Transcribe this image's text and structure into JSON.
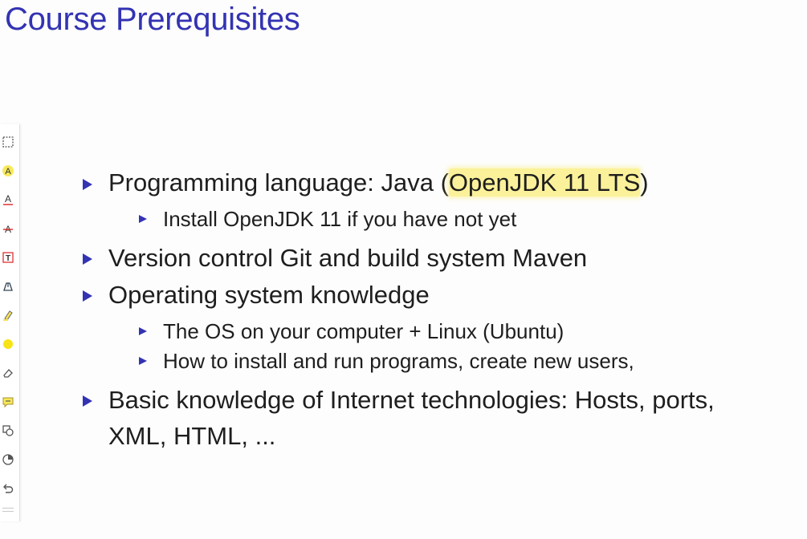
{
  "slide": {
    "title": "Course Prerequisites",
    "items": [
      {
        "pre": "Programming language: Java (",
        "highlight": "OpenJDK 11 LTS",
        "post": ")",
        "sub": [
          "Install OpenJDK 11 if you have not yet"
        ]
      },
      {
        "text": "Version control Git and build system Maven"
      },
      {
        "text": "Operating system knowledge",
        "sub": [
          "The OS on your computer + Linux (Ubuntu)",
          "How to install and run programs, create new users,"
        ]
      },
      {
        "line1": "Basic knowledge of Internet technologies: Hosts, ports,",
        "line2": "XML, HTML, ..."
      }
    ]
  },
  "toolbar": {
    "tools": [
      "rectangle-select-icon",
      "highlight-text-icon",
      "underline-text-icon",
      "strikethrough-text-icon",
      "text-box-icon",
      "pen-icon",
      "highlighter-icon",
      "color-dot-icon",
      "eraser-icon",
      "comment-icon",
      "shapes-icon",
      "stamp-icon",
      "undo-icon"
    ]
  },
  "colors": {
    "title": "#3333b3",
    "bullet": "#3333b3",
    "highlight": "#faec78",
    "text": "#1e1e1e"
  }
}
